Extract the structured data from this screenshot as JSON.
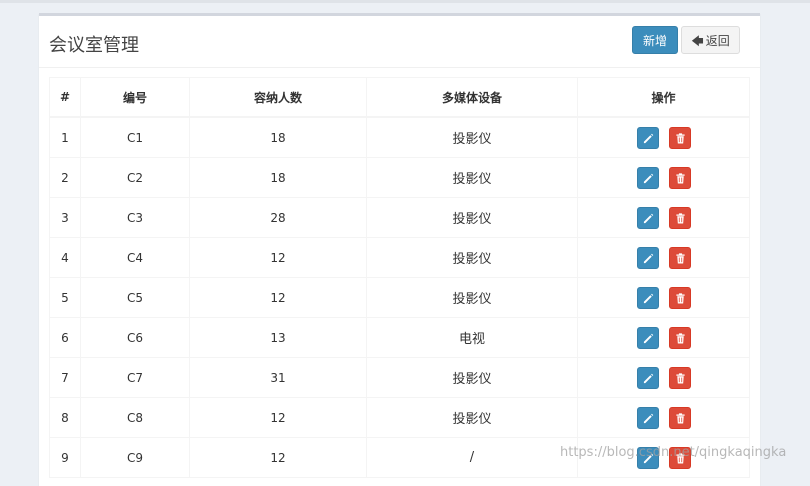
{
  "header": {
    "title": "会议室管理",
    "add_label": "新增",
    "back_label": "返回",
    "back_icon": "arrow-left-icon"
  },
  "table": {
    "columns": [
      "#",
      "编号",
      "容纳人数",
      "多媒体设备",
      "操作"
    ],
    "rows": [
      {
        "idx": "1",
        "code": "C1",
        "capacity": "18",
        "media": "投影仪"
      },
      {
        "idx": "2",
        "code": "C2",
        "capacity": "18",
        "media": "投影仪"
      },
      {
        "idx": "3",
        "code": "C3",
        "capacity": "28",
        "media": "投影仪"
      },
      {
        "idx": "4",
        "code": "C4",
        "capacity": "12",
        "media": "投影仪"
      },
      {
        "idx": "5",
        "code": "C5",
        "capacity": "12",
        "media": "投影仪"
      },
      {
        "idx": "6",
        "code": "C6",
        "capacity": "13",
        "media": "电视"
      },
      {
        "idx": "7",
        "code": "C7",
        "capacity": "31",
        "media": "投影仪"
      },
      {
        "idx": "8",
        "code": "C8",
        "capacity": "12",
        "media": "投影仪"
      },
      {
        "idx": "9",
        "code": "C9",
        "capacity": "12",
        "media": "/"
      }
    ]
  },
  "watermark": "https://blog.csdn.net/qingkaqingka",
  "colors": {
    "primary": "#3c8dbc",
    "danger": "#dd4b39"
  }
}
